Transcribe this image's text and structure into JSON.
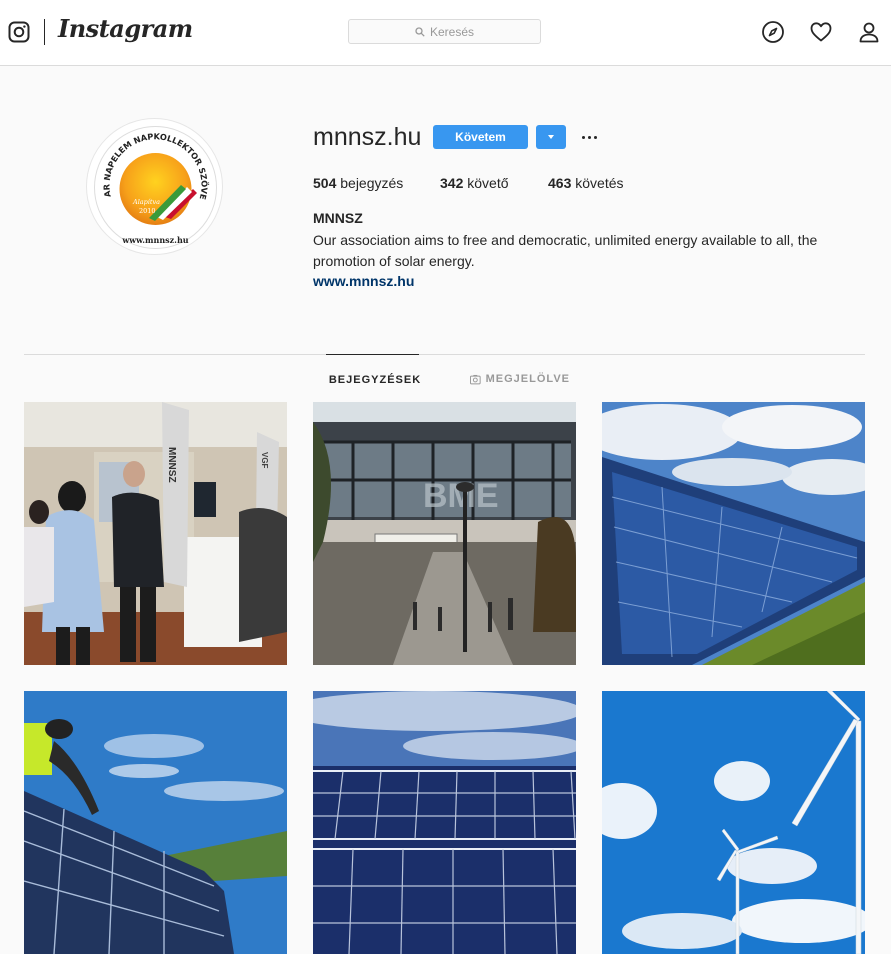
{
  "nav": {
    "wordmark": "Instagram",
    "search_placeholder": "Keresés"
  },
  "profile": {
    "username": "mnnsz.hu",
    "follow_label": "Követem",
    "stats": [
      {
        "count": "504",
        "label": " bejegyzés"
      },
      {
        "count": "342",
        "label": " követő"
      },
      {
        "count": "463",
        "label": " követés"
      }
    ],
    "full_name": "MNNSZ",
    "bio": "Our association aims to free and democratic, unlimited energy available to all, the promotion of solar energy.",
    "website": "www.mnnsz.hu",
    "avatar_text": {
      "ring": "MAGYAR NAPELEM NAPKOLLEKTOR SZÖVETSÉG",
      "founded": "Alapítva",
      "year": "2010",
      "url": "www.mnnsz.hu"
    }
  },
  "tabs": [
    {
      "label": "BEJEGYZÉSEK",
      "active": true
    },
    {
      "label": "MEGJELÖLVE",
      "active": false
    }
  ],
  "posts": [
    {
      "name": "expo-booth-photo",
      "stand_text": "MNNSZ",
      "sign_text": "VGF"
    },
    {
      "name": "university-building-photo",
      "banner_text": "BME"
    },
    {
      "name": "solar-panels-field-photo"
    },
    {
      "name": "solar-installer-photo"
    },
    {
      "name": "solar-array-closeup-photo"
    },
    {
      "name": "wind-turbines-photo"
    }
  ],
  "colors": {
    "accent": "#3897f0",
    "link": "#003569",
    "border": "#dbdbdb"
  }
}
